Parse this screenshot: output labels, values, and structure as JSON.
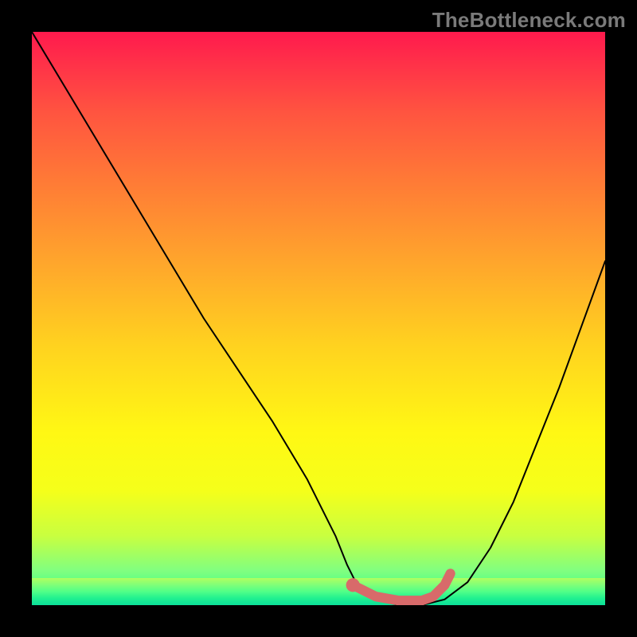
{
  "watermark": "TheBottleneck.com",
  "chart_data": {
    "type": "line",
    "title": "",
    "xlabel": "",
    "ylabel": "",
    "xlim": [
      0,
      100
    ],
    "ylim": [
      0,
      100
    ],
    "grid": false,
    "series": [
      {
        "name": "curve",
        "color": "#000000",
        "x": [
          0,
          6,
          12,
          18,
          24,
          30,
          36,
          42,
          48,
          53,
          55,
          57,
          60,
          64,
          68,
          72,
          76,
          80,
          84,
          88,
          92,
          96,
          100
        ],
        "y": [
          100,
          90,
          80,
          70,
          60,
          50,
          41,
          32,
          22,
          12,
          7,
          3,
          1,
          0,
          0,
          1,
          4,
          10,
          18,
          28,
          38,
          49,
          60
        ]
      }
    ],
    "bottleneck_segment": {
      "color": "#d86a6a",
      "x": [
        56,
        60,
        64,
        68,
        70,
        72,
        73
      ],
      "y": [
        3.5,
        1.5,
        0.8,
        0.8,
        1.5,
        3.5,
        5.5
      ]
    },
    "bottleneck_dot": {
      "x": 56,
      "y": 3.5,
      "r": 1.2,
      "color": "#d86a6a"
    },
    "background": {
      "gradient": [
        "#ff1a4d",
        "#ff7a36",
        "#ffd31f",
        "#f5ff1a",
        "#1aff8c"
      ]
    }
  }
}
